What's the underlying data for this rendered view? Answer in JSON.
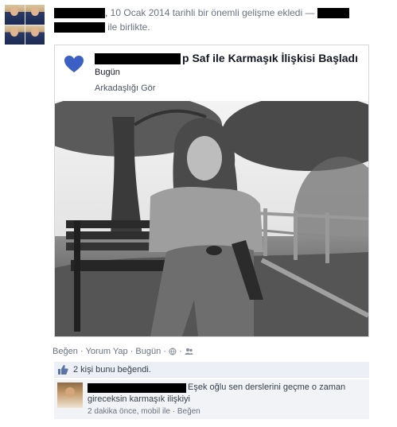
{
  "story": {
    "date_text": "10 Ocak 2014 tarihli bir önemli gelişme ekledi —",
    "with_text": "ile birlikte."
  },
  "life_event": {
    "title_suffix": "p Saf ile Karmaşık İlişkisi Başladı",
    "date": "Bugün",
    "friendship_link": "Arkadaşlığı Gör"
  },
  "actions": {
    "like": "Beğen",
    "comment": "Yorum Yap",
    "date": "Bugün",
    "dot": "·"
  },
  "likes": {
    "text": "2 kişi bunu beğendi."
  },
  "comment": {
    "line1": "Eşek oğlu sen derslerini geçme o zaman",
    "line2": "gireceksin karmaşık ilişkiyi",
    "meta": "2 dakika önce, mobil ile · Beğen"
  },
  "colors": {
    "heart": "#3b5fc4",
    "card_border": "#d3d6db",
    "likes_bg": "#eceff5",
    "comment_bg": "#f2f3f6"
  },
  "icons": [
    "heart-icon",
    "like-thumb-icon",
    "globe-icon",
    "friends-icon"
  ]
}
